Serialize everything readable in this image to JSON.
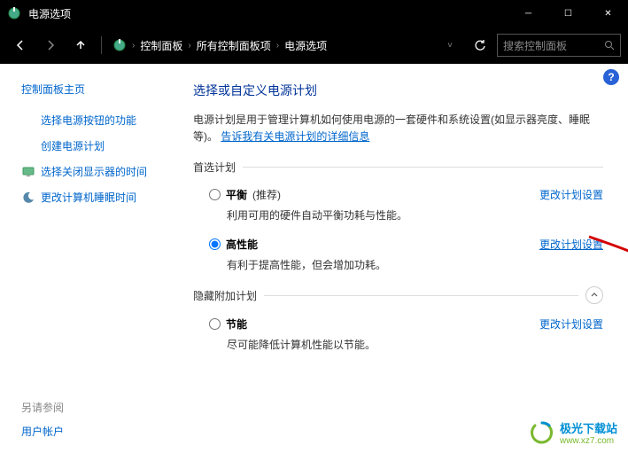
{
  "titlebar": {
    "title": "电源选项"
  },
  "breadcrumb": {
    "items": [
      "控制面板",
      "所有控制面板项",
      "电源选项"
    ]
  },
  "search": {
    "placeholder": "搜索控制面板"
  },
  "sidebar": {
    "home": "控制面板主页",
    "links": [
      {
        "label": "选择电源按钮的功能"
      },
      {
        "label": "创建电源计划"
      },
      {
        "label": "选择关闭显示器的时间"
      },
      {
        "label": "更改计算机睡眠时间"
      }
    ],
    "footer_label": "另请参阅",
    "footer_link": "用户帐户"
  },
  "main": {
    "heading": "选择或自定义电源计划",
    "desc_pre": "电源计划是用于管理计算机如何使用电源的一套硬件和系统设置(如显示器亮度、睡眠等)。",
    "desc_link": "告诉我有关电源计划的详细信息",
    "group1": "首选计划",
    "group2": "隐藏附加计划",
    "plans": [
      {
        "name": "平衡",
        "suffix": "(推荐)",
        "desc": "利用可用的硬件自动平衡功耗与性能。",
        "link": "更改计划设置",
        "checked": false,
        "highlighted": false
      },
      {
        "name": "高性能",
        "suffix": "",
        "desc": "有利于提高性能，但会增加功耗。",
        "link": "更改计划设置",
        "checked": true,
        "highlighted": true
      }
    ],
    "hidden_plans": [
      {
        "name": "节能",
        "suffix": "",
        "desc": "尽可能降低计算机性能以节能。",
        "link": "更改计划设置",
        "checked": false,
        "highlighted": false
      }
    ]
  },
  "watermark": {
    "line1": "极光下载站",
    "line2": "www.xz7.com"
  }
}
